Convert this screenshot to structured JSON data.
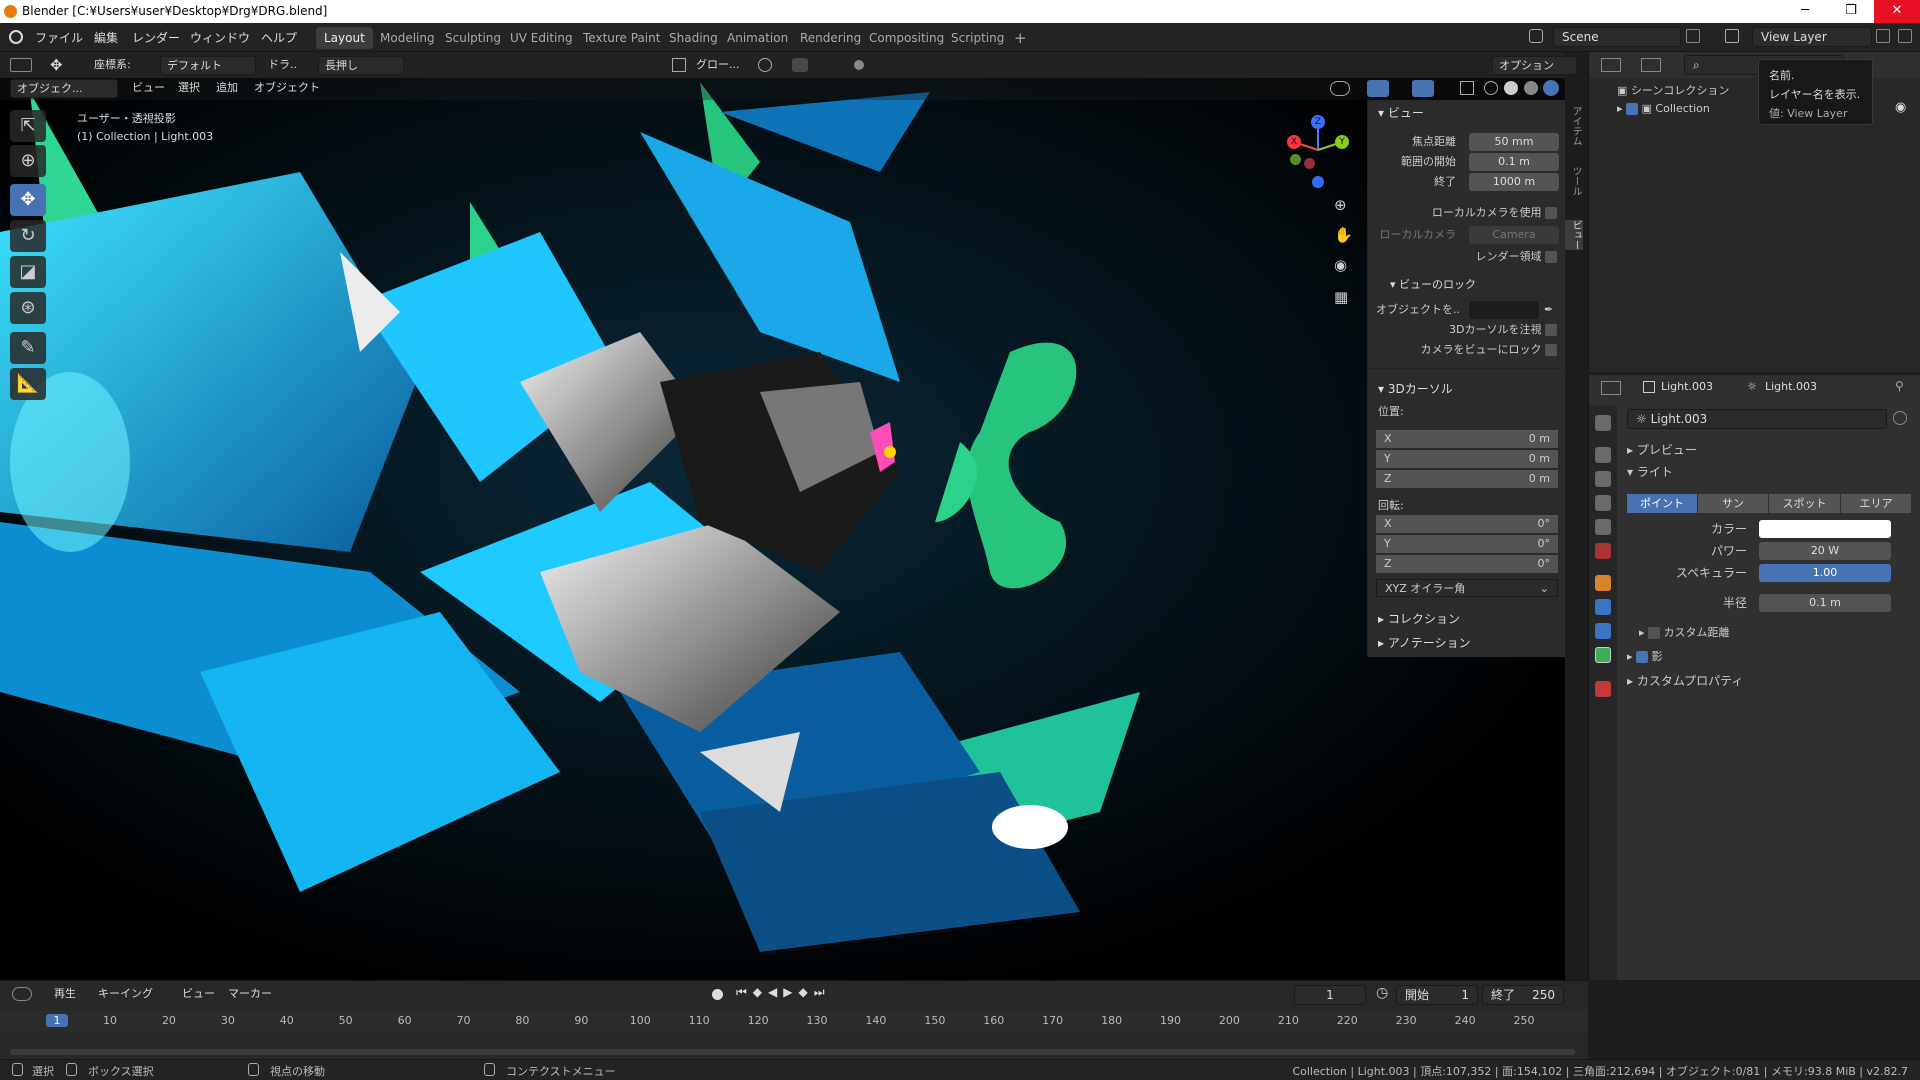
{
  "window": {
    "title": "Blender [C:¥Users¥user¥Desktop¥Drg¥DRG.blend]",
    "min_glyph": "─",
    "max_glyph": "❐",
    "close_glyph": "✕"
  },
  "topbar": {
    "menus": [
      "ファイル",
      "編集",
      "レンダー",
      "ウィンドウ",
      "ヘルプ"
    ],
    "workspaces": [
      "Layout",
      "Modeling",
      "Sculpting",
      "UV Editing",
      "Texture Paint",
      "Shading",
      "Animation",
      "Rendering",
      "Compositing",
      "Scripting"
    ],
    "add_tab": "+",
    "scene": "Scene",
    "view_layer": "View Layer"
  },
  "toolheader": {
    "coord_label": "座標系:",
    "coord_value": "デフォルト",
    "drag_label": "ドラ..",
    "drag_value": "長押し",
    "pivot": "グロー...",
    "options": "オプション"
  },
  "viewport_header": {
    "mode": "オブジェク...",
    "menus": [
      "ビュー",
      "選択",
      "追加",
      "オブジェクト"
    ]
  },
  "viewport": {
    "overlay_line1": "ユーザー・透視投影",
    "overlay_line2": "(1) Collection | Light.003",
    "gizmo": {
      "x": "X",
      "y": "Y",
      "z": "Z"
    }
  },
  "npanel": {
    "tabs": [
      "アイテム",
      "ツール",
      "ビュー"
    ],
    "view_header": "ビュー",
    "focal_label": "焦点距離",
    "focal_value": "50 mm",
    "clip_start_label": "範囲の開始",
    "clip_start_value": "0.1 m",
    "clip_end_label": "終了",
    "clip_end_value": "1000 m",
    "local_camera_use": "ローカルカメラを使用",
    "local_camera_label": "ローカルカメラ",
    "local_camera_value": "Camera",
    "render_region": "レンダー領域",
    "view_lock_header": "ビューのロック",
    "lock_object_label": "オブジェクトを..",
    "lock_cursor": "3Dカーソルを注視",
    "lock_camera": "カメラをビューにロック",
    "cursor_header": "3Dカーソル",
    "location_label": "位置:",
    "loc": [
      {
        "axis": "X",
        "value": "0 m"
      },
      {
        "axis": "Y",
        "value": "0 m"
      },
      {
        "axis": "Z",
        "value": "0 m"
      }
    ],
    "rotation_label": "回転:",
    "rot": [
      {
        "axis": "X",
        "value": "0°"
      },
      {
        "axis": "Y",
        "value": "0°"
      },
      {
        "axis": "Z",
        "value": "0°"
      }
    ],
    "rot_mode": "XYZ オイラー角",
    "collection_header": "コレクション",
    "annotation_header": "アノテーション"
  },
  "outliner": {
    "scene_collection": "シーンコレクション",
    "collection": "Collection"
  },
  "tooltip": {
    "line1": "名前.",
    "line2": "レイヤー名を表示.",
    "line3": "値: View Layer"
  },
  "properties": {
    "object_name": "Light.003",
    "data_name": "Light.003",
    "datablock": "Light.003",
    "preview": "プレビュー",
    "light": "ライト",
    "types": [
      "ポイント",
      "サン",
      "スポット",
      "エリア"
    ],
    "color_label": "カラー",
    "power_label": "パワー",
    "power_value": "20 W",
    "specular_label": "スペキュラー",
    "specular_value": "1.00",
    "radius_label": "半径",
    "radius_value": "0.1 m",
    "custom_distance": "カスタム距離",
    "shadow": "影",
    "custom_props": "カスタムプロパティ"
  },
  "timeline": {
    "menus": [
      "再生",
      "キーイング",
      "ビュー",
      "マーカー"
    ],
    "current_frame": "1",
    "start_label": "開始",
    "start_value": "1",
    "end_label": "終了",
    "end_value": "250",
    "ticks": [
      "1",
      "10",
      "20",
      "30",
      "40",
      "50",
      "60",
      "70",
      "80",
      "90",
      "100",
      "110",
      "120",
      "130",
      "140",
      "150",
      "160",
      "170",
      "180",
      "190",
      "200",
      "210",
      "220",
      "230",
      "240",
      "250"
    ]
  },
  "statusbar": {
    "select": "選択",
    "box_select": "ボックス選択",
    "rotate_view": "視点の移動",
    "context_menu": "コンテクストメニュー",
    "stats": "Collection | Light.003 | 頂点:107,352 | 面:154,102 | 三角面:212,694 | オブジェクト:0/81 | メモリ:93.8 MiB | v2.82.7"
  }
}
